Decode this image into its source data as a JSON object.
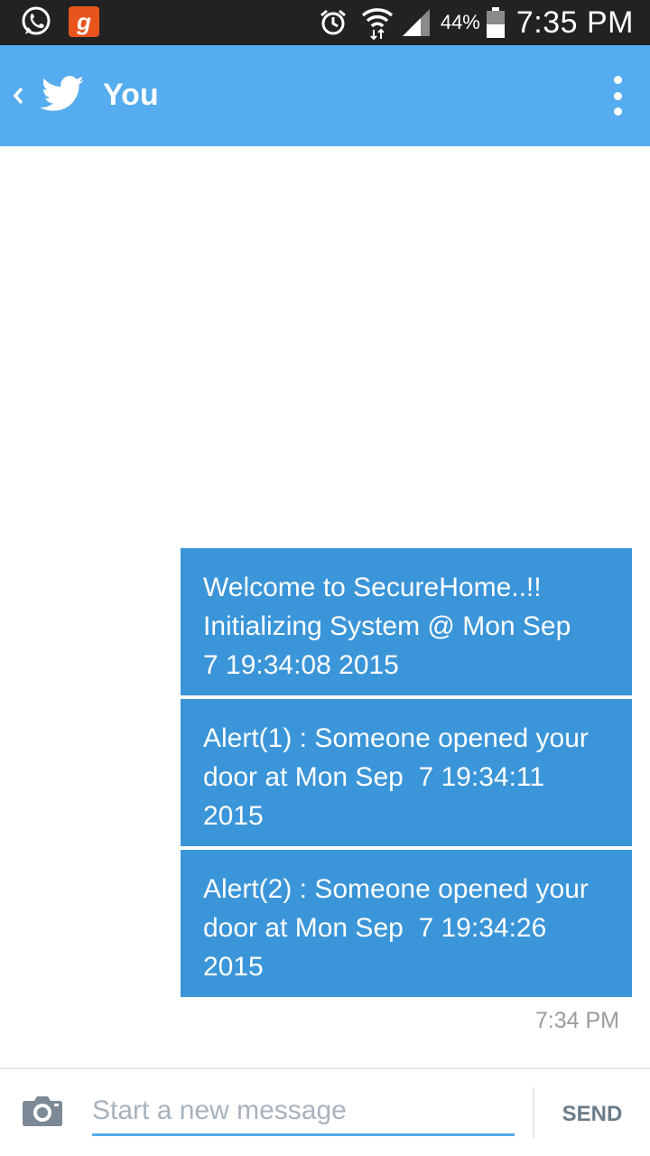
{
  "status_bar": {
    "battery_percent": "44%",
    "time": "7:35 PM",
    "icons": [
      "whatsapp-icon",
      "gaana-icon",
      "alarm-icon",
      "wifi-icon",
      "signal-icon",
      "battery-icon"
    ],
    "gaana_letter": "g"
  },
  "app_bar": {
    "title": "You",
    "color": "#55acee",
    "icons": [
      "back-chevron-icon",
      "twitter-bird-icon",
      "overflow-menu-icon"
    ]
  },
  "messages": [
    {
      "text": "Welcome to SecureHome..!!\nInitializing System @ Mon Sep\n7 19:34:08 2015"
    },
    {
      "text": "Alert(1) : Someone opened your\ndoor at Mon Sep  7 19:34:11\n2015"
    },
    {
      "text": "Alert(2) : Someone opened your\ndoor at Mon Sep  7 19:34:26\n2015"
    }
  ],
  "message_bubble_color": "#3b95d9",
  "last_timestamp": "7:34 PM",
  "compose": {
    "placeholder": "Start a new message",
    "send_label": "SEND",
    "camera_icon": "camera-icon"
  }
}
